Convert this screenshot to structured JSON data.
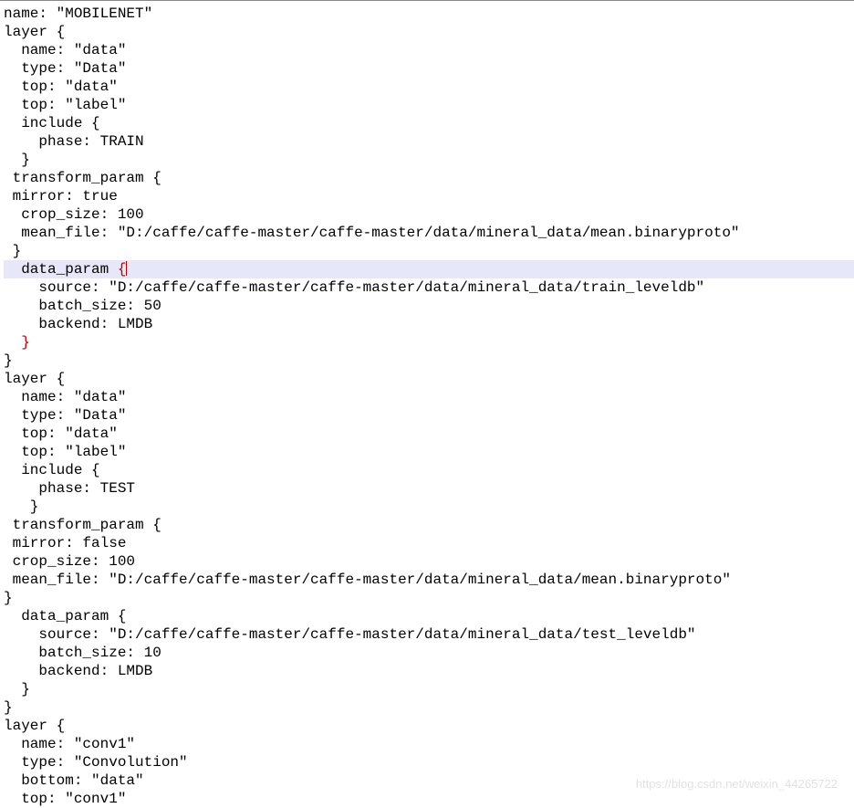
{
  "lines": [
    {
      "t": "name: \"MOBILENET\""
    },
    {
      "t": "layer {"
    },
    {
      "t": "  name: \"data\""
    },
    {
      "t": "  type: \"Data\""
    },
    {
      "t": "  top: \"data\""
    },
    {
      "t": "  top: \"label\""
    },
    {
      "t": "  include {"
    },
    {
      "t": "    phase: TRAIN"
    },
    {
      "t": "  }"
    },
    {
      "t": " transform_param {"
    },
    {
      "t": " mirror: true"
    },
    {
      "t": "  crop_size: 100"
    },
    {
      "t": "  mean_file: \"D:/caffe/caffe-master/caffe-master/data/mineral_data/mean.binaryproto\""
    },
    {
      "t": " }"
    },
    {
      "t": "  data_param ",
      "hl": true,
      "openBrace": true,
      "cursor": true
    },
    {
      "t": "    source: \"D:/caffe/caffe-master/caffe-master/data/mineral_data/train_leveldb\""
    },
    {
      "t": "    batch_size: 50"
    },
    {
      "t": "    backend: LMDB"
    },
    {
      "t": "  ",
      "closeBrace": true
    },
    {
      "t": "}"
    },
    {
      "t": "layer {"
    },
    {
      "t": "  name: \"data\""
    },
    {
      "t": "  type: \"Data\""
    },
    {
      "t": "  top: \"data\""
    },
    {
      "t": "  top: \"label\""
    },
    {
      "t": "  include {"
    },
    {
      "t": "    phase: TEST"
    },
    {
      "t": "   }"
    },
    {
      "t": " transform_param {"
    },
    {
      "t": " mirror: false"
    },
    {
      "t": " crop_size: 100"
    },
    {
      "t": " mean_file: \"D:/caffe/caffe-master/caffe-master/data/mineral_data/mean.binaryproto\""
    },
    {
      "t": "}"
    },
    {
      "t": "  data_param {"
    },
    {
      "t": "    source: \"D:/caffe/caffe-master/caffe-master/data/mineral_data/test_leveldb\""
    },
    {
      "t": "    batch_size: 10"
    },
    {
      "t": "    backend: LMDB"
    },
    {
      "t": "  }"
    },
    {
      "t": "}"
    },
    {
      "t": "layer {"
    },
    {
      "t": "  name: \"conv1\""
    },
    {
      "t": "  type: \"Convolution\""
    },
    {
      "t": "  bottom: \"data\""
    },
    {
      "t": "  top: \"conv1\""
    }
  ],
  "watermark": "https://blog.csdn.net/weixin_44265722"
}
